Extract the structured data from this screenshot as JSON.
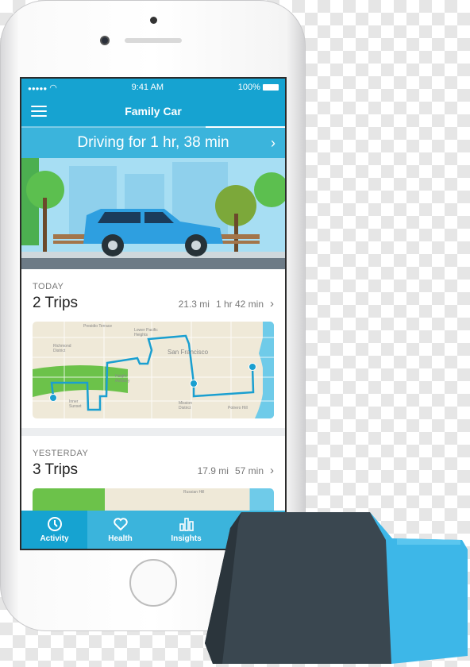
{
  "status_bar": {
    "signal": "●●●●●",
    "wifi_icon": "wifi-icon",
    "time": "9:41 AM",
    "battery": "100%"
  },
  "nav": {
    "title": "Family Car",
    "menu_icon": "hamburger-icon"
  },
  "banner": {
    "text": "Driving for 1 hr, 38 min",
    "chevron": "›"
  },
  "cards": [
    {
      "label": "TODAY",
      "trips": "2 Trips",
      "distance": "21.3 mi",
      "duration": "1 hr 42 min",
      "chevron": "›",
      "map_labels": [
        "Presidio Terrace",
        "Lower Pacific Heights",
        "Richmond District",
        "San Francisco",
        "Haight Ashbury",
        "Inner Sunset",
        "Mission District",
        "Potrero Hill"
      ]
    },
    {
      "label": "YESTERDAY",
      "trips": "3 Trips",
      "distance": "17.9 mi",
      "duration": "57 min",
      "chevron": "›",
      "map_labels": [
        "Russian Hill"
      ]
    }
  ],
  "tabbar": [
    {
      "label": "Activity",
      "icon": "clock-icon",
      "active": true
    },
    {
      "label": "Health",
      "icon": "heart-icon"
    },
    {
      "label": "Insights",
      "icon": "bar-chart-icon"
    }
  ],
  "colors": {
    "primary": "#16a3d1",
    "secondary": "#3bb4dc",
    "route": "#1a9fd0",
    "device_body": "#3a4750",
    "device_plug": "#3db7e8"
  }
}
